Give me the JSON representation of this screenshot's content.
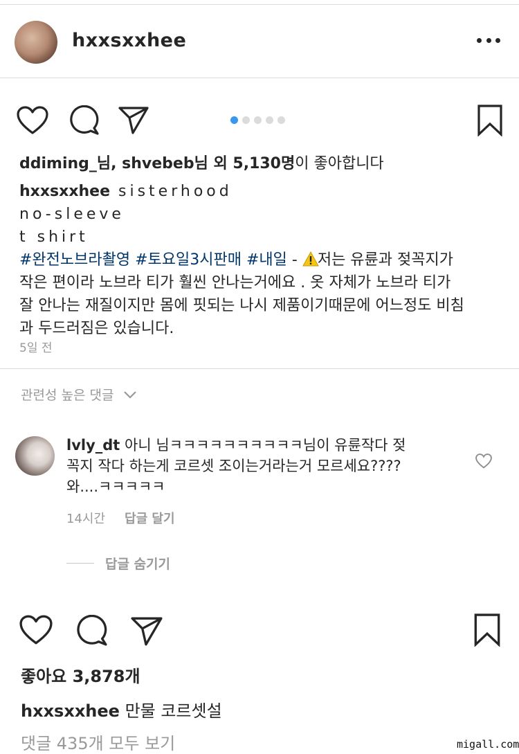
{
  "post": {
    "username": "hxxsxxhee",
    "likes_prefix_users": "ddiming_님, shvebeb님 외 ",
    "likes_count": "5,130명",
    "likes_suffix": "이 좋아합니다",
    "caption_user": "hxxsxxhee",
    "caption_line1": " sisterhood",
    "caption_line2": "no-sleeve",
    "caption_line3": "t shirt",
    "hashtags": "#완전노브라촬영 #토요일3시판매 #내일",
    "caption_dash": " - ",
    "caption_text_a": "저는 유륜과 젖꼭지가",
    "caption_text_b": "작은 편이라 노브라 티가 훨씬 안나는거에요 . 옷 자체가 노브라 티가",
    "caption_text_c": "잘 안나는 재질이지만 몸에 핏되는 나시 제품이기때문에 어느정도 비침",
    "caption_text_d": "과 두드러짐은 있습니다.",
    "time_ago": "5일 전",
    "carousel_total": 5,
    "carousel_active": 1
  },
  "comments_section": {
    "related_label": "관련성 높은 댓글"
  },
  "comment": {
    "username": "lvly_dt",
    "text_line1": " 아니 님ㅋㅋㅋㅋㅋㅋㅋㅋㅋㅋ님이 유륜작다 젖",
    "text_line2": "꼭지 작다 하는게 코르셋 조이는거라는거 모르세요????",
    "text_line3": "와....ㅋㅋㅋㅋㅋ",
    "time": "14시간",
    "reply_label": "답글 달기",
    "hide_replies_label": "답글 숨기기"
  },
  "post2": {
    "likes": "좋아요 3,878개",
    "caption_user": "hxxsxxhee",
    "caption_text": " 만물 코르셋설",
    "view_all_comments": "댓글 435개 모두 보기"
  },
  "watermark": "migall.com",
  "colors": {
    "text": "#262626",
    "muted": "#999999",
    "hashtag": "#003569",
    "active_dot": "#3897f0",
    "divider": "#dbdbdb"
  },
  "icons": [
    "heart-icon",
    "comment-icon",
    "share-icon",
    "bookmark-icon",
    "more-icon",
    "chevron-down-icon",
    "warning-icon"
  ]
}
